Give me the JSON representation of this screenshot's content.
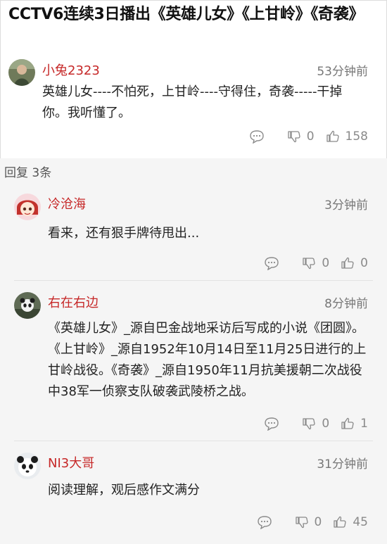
{
  "topic_title": "CCTV6连续3日播出《英雄儿女》《上甘岭》《奇袭》",
  "main_comment": {
    "username": "小兔2323",
    "time": "53分钟前",
    "text": "英雄儿女----不怕死，上甘岭----守得住，奇袭-----干掉你。我听懂了。",
    "dislike_count": "0",
    "like_count": "158"
  },
  "replies_header": "回复 3条",
  "replies": [
    {
      "username": "冷沧海",
      "time": "3分钟前",
      "text": "看来，还有狠手牌待甩出...",
      "dislike_count": "0",
      "like_count": "0"
    },
    {
      "username": "右在右边",
      "time": "8分钟前",
      "text": "《英雄儿女》_源自巴金战地采访后写成的小说《团圆》。《上甘岭》_源自1952年10月14日至11月25日进行的上甘岭战役。《奇袭》_源自1950年11月抗美援朝二次战役中38军一侦察支队破袭武陵桥之战。",
      "dislike_count": "0",
      "like_count": "1"
    },
    {
      "username": "NI3大哥",
      "time": "31分钟前",
      "text": "阅读理解，观后感作文满分",
      "dislike_count": "0",
      "like_count": "45"
    }
  ],
  "colors": {
    "username": "#c62828",
    "replies_background": "#f5f5f5",
    "meta_gray": "#8a8a8a"
  },
  "icons": [
    "comment-icon",
    "dislike-icon",
    "like-icon"
  ]
}
